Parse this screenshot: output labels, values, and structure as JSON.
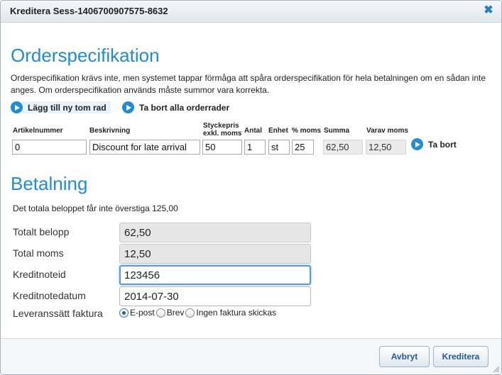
{
  "dialog": {
    "title": "Kreditera Sess-1406700907575-8632",
    "close_glyph": "✖"
  },
  "order": {
    "heading": "Orderspecifikation",
    "description": "Orderspecifikation krävs inte, men systemet tappar förmåga att spåra orderspecifikation för hela betalningen om en sådan inte anges. Om orderspecifikation används måste summor vara korrekta.",
    "add_row_label": "Lägg till ny tom rad",
    "remove_all_label": "Ta bort alla orderrader",
    "columns": {
      "article": "Artikelnummer",
      "description": "Beskrivning",
      "unit_price_line1": "Styckepris",
      "unit_price_line2": "exkl. moms",
      "quantity": "Antal",
      "unit": "Enhet",
      "vat_pct": "% moms",
      "sum": "Summa",
      "of_which_vat": "Varav moms"
    },
    "rows": [
      {
        "article": "0",
        "description": "Discount for late arrival",
        "unit_price": "50",
        "quantity": "1",
        "unit": "st",
        "vat_pct": "25",
        "sum": "62,50",
        "vat": "12,50",
        "remove_label": "Ta bort"
      }
    ]
  },
  "payment": {
    "heading": "Betalning",
    "description": "Det totala beloppet får inte överstiga 125,00",
    "fields": {
      "total_amount": {
        "label": "Totalt belopp",
        "value": "62,50"
      },
      "total_vat": {
        "label": "Total moms",
        "value": "12,50"
      },
      "credit_note_id": {
        "label": "Kreditnoteid",
        "value": "123456"
      },
      "credit_note_date": {
        "label": "Kreditnotedatum",
        "value": "2014-07-30"
      }
    },
    "delivery": {
      "label": "Leveranssätt faktura",
      "options": [
        "E-post",
        "Brev",
        "Ingen faktura skickas"
      ],
      "selected": "E-post"
    }
  },
  "footer": {
    "cancel_label": "Avbryt",
    "submit_label": "Kreditera"
  },
  "colors": {
    "accent": "#1f8dd6",
    "button_text": "#1e5c96"
  },
  "icons": {
    "close": "close-icon",
    "action": "play-circle-icon",
    "resize": "resize-grip-icon"
  }
}
